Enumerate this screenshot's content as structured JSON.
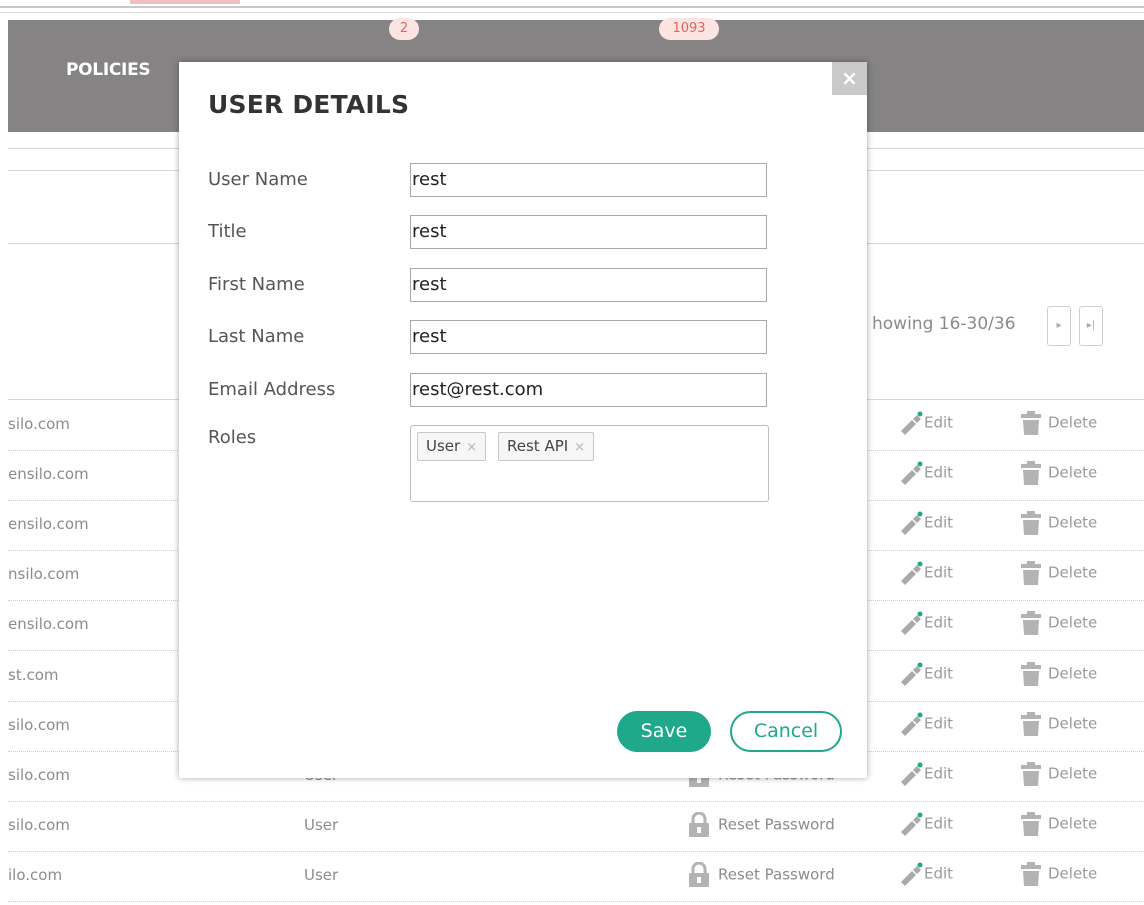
{
  "header": {
    "nav_label": "POLICIES",
    "badge_1": "2",
    "badge_2": "1093"
  },
  "pagination": {
    "showing": "howing 16-30/36",
    "next_icon": "▸",
    "last_icon": "▸|"
  },
  "table": {
    "edit_label": "Edit",
    "delete_label": "Delete",
    "reset_label": "Reset Password",
    "rows": [
      {
        "email": "silo.com",
        "role": ""
      },
      {
        "email": "ensilo.com",
        "role": ""
      },
      {
        "email": "ensilo.com",
        "role": ""
      },
      {
        "email": "nsilo.com",
        "role": ""
      },
      {
        "email": "ensilo.com",
        "role": ""
      },
      {
        "email": "st.com",
        "role": ""
      },
      {
        "email": "silo.com",
        "role": ""
      },
      {
        "email": "silo.com",
        "role": "User"
      },
      {
        "email": "silo.com",
        "role": "User"
      },
      {
        "email": "ilo.com",
        "role": "User"
      }
    ]
  },
  "modal": {
    "title": "USER DETAILS",
    "close_icon": "×",
    "fields": {
      "user_name": {
        "label": "User Name",
        "value": "rest"
      },
      "title": {
        "label": "Title",
        "value": "rest"
      },
      "first_name": {
        "label": "First Name",
        "value": "rest"
      },
      "last_name": {
        "label": "Last Name",
        "value": "rest"
      },
      "email": {
        "label": "Email Address",
        "value": "rest@rest.com"
      }
    },
    "roles_label": "Roles",
    "roles": [
      "User",
      "Rest API"
    ],
    "tag_remove_icon": "×",
    "save_label": "Save",
    "cancel_label": "Cancel"
  },
  "colors": {
    "accent": "#1fa88a",
    "header_bg": "#858383",
    "badge_text": "#e0675f"
  }
}
